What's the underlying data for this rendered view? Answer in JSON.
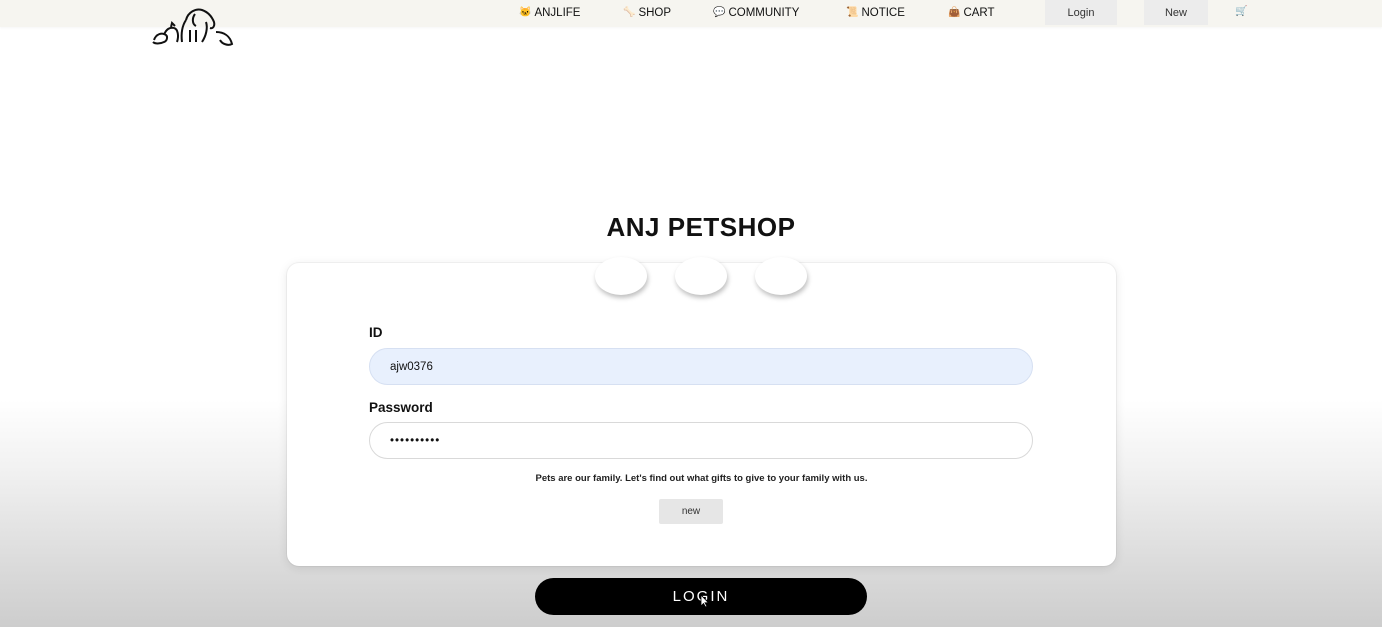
{
  "nav": {
    "items": [
      {
        "icon": "🐱",
        "icon_name": "cat-icon",
        "label": "ANJLIFE"
      },
      {
        "icon": "🦴",
        "icon_name": "bone-icon",
        "label": "SHOP"
      },
      {
        "icon": "💬",
        "icon_name": "chat-bubble-icon",
        "label": "COMMUNITY"
      },
      {
        "icon": "📜",
        "icon_name": "scroll-icon",
        "label": "NOTICE"
      },
      {
        "icon": "👜",
        "icon_name": "bag-icon",
        "label": "CART"
      }
    ],
    "login_label": "Login",
    "new_label": "New",
    "cart_glyph": "🛒"
  },
  "main": {
    "title": "ANJ PETSHOP",
    "id_label": "ID",
    "id_value": "ajw0376",
    "password_label": "Password",
    "password_value": "**********",
    "tagline": "Pets are our family. Let's find out what gifts to give to your family with us.",
    "new_button": "new",
    "login_button": "LOGIN"
  },
  "colors": {
    "topbar_bg": "#f6f5f0",
    "id_field_bg": "#e8f0fd",
    "login_button_bg": "#000000"
  }
}
